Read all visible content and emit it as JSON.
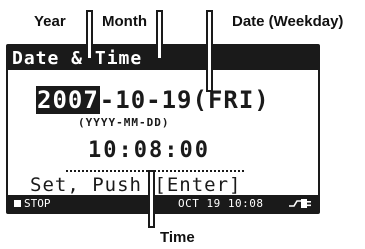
{
  "callouts": {
    "year": "Year",
    "month": "Month",
    "date_weekday": "Date (Weekday)",
    "time": "Time"
  },
  "screen": {
    "title": "Date & Time",
    "date": {
      "year": "2007",
      "rest": "-10-19(FRI)"
    },
    "format_hint": "(YYYY-MM-DD)",
    "time": "10:08:00",
    "prompt": "Set, Push [Enter]",
    "status": {
      "mode": "STOP",
      "clock": "OCT 19 10:08"
    }
  },
  "icons": {
    "stop": "stop-square-icon",
    "power": "ac-plug-icon"
  }
}
